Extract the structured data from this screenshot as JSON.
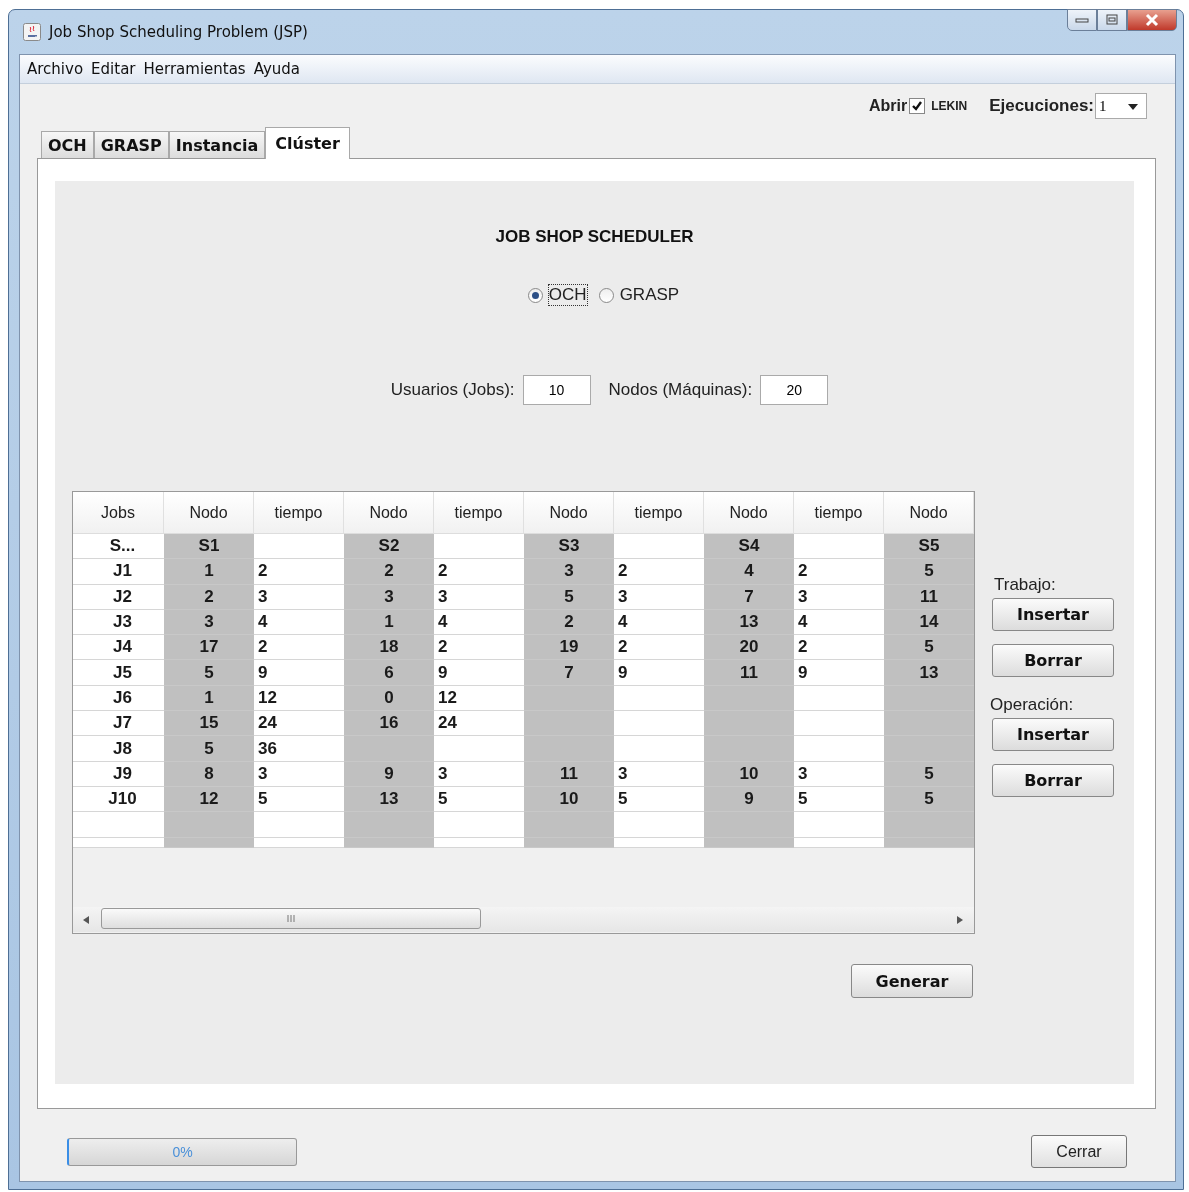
{
  "window": {
    "title": "Job Shop Scheduling Problem (JSP)"
  },
  "menu": [
    "Archivo",
    "Editar",
    "Herramientas",
    "Ayuda"
  ],
  "options": {
    "open_label": "Abrir",
    "lekin": {
      "label": "LEKIN",
      "checked": true
    },
    "runs_label": "Ejecuciones:",
    "runs_value": "1"
  },
  "tabs": [
    {
      "label": "OCH",
      "selected": false
    },
    {
      "label": "GRASP",
      "selected": false
    },
    {
      "label": "Instancia",
      "selected": false
    },
    {
      "label": "Clúster",
      "selected": true
    }
  ],
  "panel": {
    "heading": "JOB SHOP SCHEDULER",
    "algorithms": [
      {
        "label": "OCH",
        "selected": true
      },
      {
        "label": "GRASP",
        "selected": false
      }
    ],
    "fields": [
      {
        "label": "Usuarios (Jobs):",
        "value": "10"
      },
      {
        "label": "Nodos (Máquinas):",
        "value": "20"
      }
    ],
    "table": {
      "columns": [
        "Jobs",
        "Nodo",
        "tiempo",
        "Nodo",
        "tiempo",
        "Nodo",
        "tiempo",
        "Nodo",
        "tiempo",
        "Nodo"
      ],
      "rows": [
        [
          "S...",
          "S1",
          null,
          "S2",
          null,
          "S3",
          null,
          "S4",
          null,
          "S5"
        ],
        [
          "J1",
          "1",
          "2",
          "2",
          "2",
          "3",
          "2",
          "4",
          "2",
          "5"
        ],
        [
          "J2",
          "2",
          "3",
          "3",
          "3",
          "5",
          "3",
          "7",
          "3",
          "11"
        ],
        [
          "J3",
          "3",
          "4",
          "1",
          "4",
          "2",
          "4",
          "13",
          "4",
          "14"
        ],
        [
          "J4",
          "17",
          "2",
          "18",
          "2",
          "19",
          "2",
          "20",
          "2",
          "5"
        ],
        [
          "J5",
          "5",
          "9",
          "6",
          "9",
          "7",
          "9",
          "11",
          "9",
          "13"
        ],
        [
          "J6",
          "1",
          "12",
          "0",
          "12",
          null,
          null,
          null,
          null,
          null
        ],
        [
          "J7",
          "15",
          "24",
          "16",
          "24",
          null,
          null,
          null,
          null,
          null
        ],
        [
          "J8",
          "5",
          "36",
          null,
          null,
          null,
          null,
          null,
          null,
          null
        ],
        [
          "J9",
          "8",
          "3",
          "9",
          "3",
          "11",
          "3",
          "10",
          "3",
          "5"
        ],
        [
          "J10",
          "12",
          "5",
          "13",
          "5",
          "10",
          "5",
          "9",
          "5",
          "5"
        ]
      ]
    },
    "job_group": {
      "label": "Trabajo:",
      "buttons": [
        "Insertar",
        "Borrar"
      ]
    },
    "operation_group": {
      "label": "Operación:",
      "buttons": [
        "Insertar",
        "Borrar"
      ]
    },
    "generate_button": "Generar"
  },
  "progress": {
    "level": 0,
    "reading": "0%"
  },
  "close_button": "Cerrar"
}
